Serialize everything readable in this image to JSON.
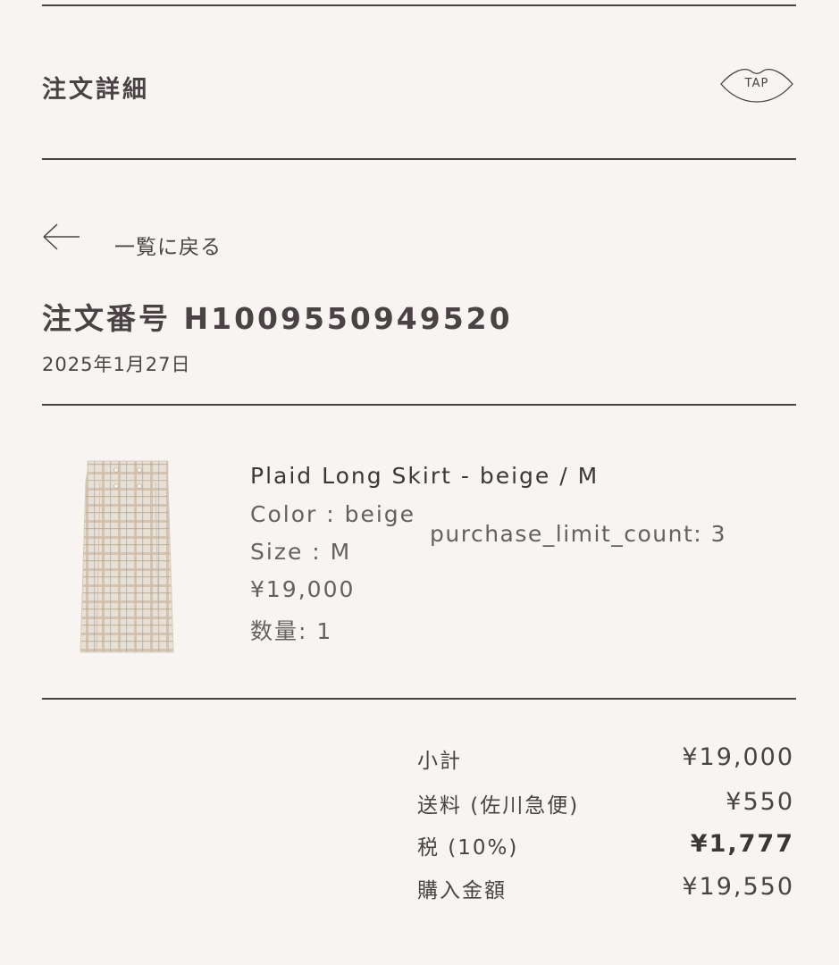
{
  "header": {
    "title": "注文詳細",
    "tap_button_label": "TAP"
  },
  "navigation": {
    "back_label": "一覧に戻る"
  },
  "order": {
    "number_label": "注文番号 H1009550949520",
    "date": "2025年1月27日"
  },
  "item": {
    "name": "Plaid Long Skirt - beige / M",
    "color": "Color : beige",
    "size": "Size : M",
    "price": "¥19,000",
    "quantity": "数量: 1",
    "purchase_limit": "purchase_limit_count: 3",
    "image_colors": {
      "base": "#e8e0d4",
      "check_a": "#c9b9a3",
      "check_b": "#b8a48c",
      "accent": "#9aa6b0"
    }
  },
  "summary": {
    "rows": [
      {
        "label": "小計",
        "value": "¥19,000"
      },
      {
        "label": "送料 (佐川急便)",
        "value": "¥550"
      },
      {
        "label": "税 (10%)",
        "value": "¥1,777"
      },
      {
        "label": "購入金額",
        "value": "¥19,550"
      }
    ]
  },
  "colors": {
    "background": "#f8f4f1",
    "text": "#4a4346",
    "rule": "#4a4346"
  }
}
